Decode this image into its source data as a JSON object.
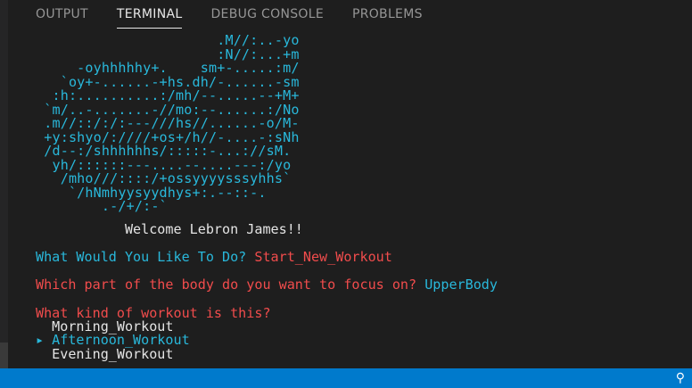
{
  "tabs": [
    {
      "label": "OUTPUT"
    },
    {
      "label": "TERMINAL"
    },
    {
      "label": "DEBUG CONSOLE"
    },
    {
      "label": "PROBLEMS"
    }
  ],
  "terminal": {
    "art": "                      .M//:..-yo\n                      :N//:...+m\n     -oyhhhhhy+.    sm+-.....:m/\n   `oy+-......-+hs.dh/-......-sm\n  :h:..........:/mh/--.....--+M+\n `m/..-.......-//mo:--......:/No\n .m//::/:/:---///hs//......-o/M-\n +y:shyo/:////+os+/h//-....-:sNh\n /d--:/shhhhhhs/:::::-...://sM.\n  yh/::::::---....--....---:/yo\n   /mho///::::/+ossyyyysssyhhs`\n    `/hNmhyysyydhys+:.--::-.\n        .-/+/:-`",
    "welcome": "           Welcome Lebron James!!",
    "q1_label": "What Would You Like To Do? ",
    "q1_answer": "Start_New_Workout",
    "q2_label": "Which part of the body do you want to focus on? ",
    "q2_answer": "UpperBody",
    "q3_label": "What kind of workout is this?",
    "options": [
      "  Morning_Workout",
      "▸ Afternoon_Workout",
      "  Evening_Workout"
    ]
  },
  "colors": {
    "panel_bg": "#1e1e1e",
    "cyan": "#29b8db",
    "red": "#f14c4c",
    "statusbar": "#007acc"
  },
  "statusbar": {
    "icon": "remote-icon"
  }
}
